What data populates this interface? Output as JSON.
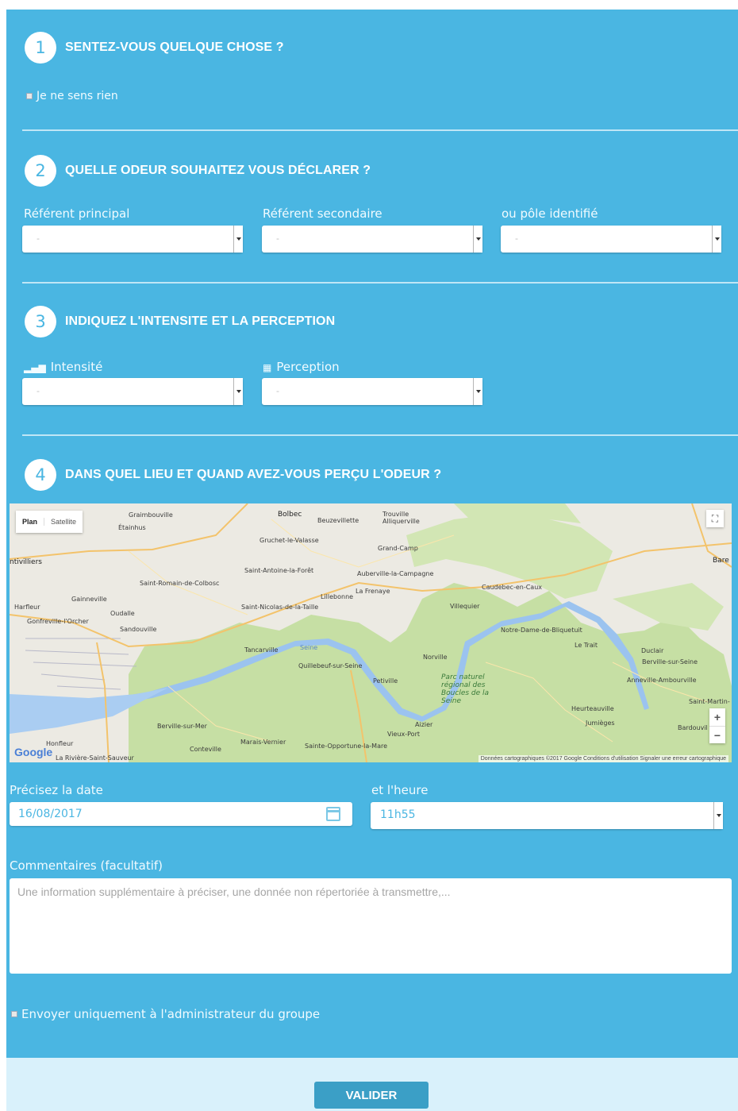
{
  "steps": [
    {
      "number": "1",
      "title": "SENTEZ-VOUS QUELQUE CHOSE ?"
    },
    {
      "number": "2",
      "title": "QUELLE ODEUR SOUHAITEZ VOUS DÉCLARER ?"
    },
    {
      "number": "3",
      "title": "INDIQUEZ L'INTENSITE ET LA PERCEPTION"
    },
    {
      "number": "4",
      "title": "DANS QUEL LIEU ET QUAND AVEZ-VOUS PERÇU L'ODEUR ?"
    }
  ],
  "section1": {
    "checkbox_label": "Je ne sens rien"
  },
  "section2": {
    "labels": [
      "Référent principal",
      "Référent secondaire",
      "ou pôle identifié"
    ],
    "select_values": [
      "-",
      "-",
      "-"
    ]
  },
  "section3": {
    "intensity_label": "Intensité",
    "perception_label": "Perception",
    "intensity_icon": "signal-bars-icon",
    "perception_icon": "table-grid-icon",
    "select_values": [
      "-",
      "-"
    ]
  },
  "map": {
    "type_plan": "Plan",
    "type_satellite": "Satellite",
    "logo": "Google",
    "attribution": "Données cartographiques ©2017 Google   Conditions d'utilisation   Signaler une erreur cartographique",
    "zoom_in": "+",
    "zoom_out": "−",
    "fullscreen": "⛶",
    "places": {
      "p1": "Graimbouville",
      "p2": "Étainhus",
      "p3": "Bolbec",
      "p4": "Beuzevillette",
      "p5": "Trouville Alliquerville",
      "p6": "Gruchet-le-Valasse",
      "p7": "Grand-Camp",
      "p8": "ntivilliers",
      "p9": "Saint-Antoine-la-Forêt",
      "p10": "Auberville-la-Campagne",
      "p11": "Saint-Romain-de-Colbosc",
      "p12": "Caudebec-en-Caux",
      "p13": "La Frenaye",
      "p14": "Lillebonne",
      "p15": "Gainneville",
      "p16": "Harfleur",
      "p17": "Saint-Nicolas-de-la-Taille",
      "p18": "Villequier",
      "p19": "Oudalle",
      "p20": "Gonfreville-l'Orcher",
      "p21": "Sandouville",
      "p22": "Notre-Dame-de-Bliquetuit",
      "p23": "Le Trait",
      "p24": "Tancarville",
      "p25": "Duclair",
      "p26": "Norville",
      "p27": "Berville-sur-Seine",
      "p28": "Quillebeuf-sur-Seine",
      "p29": "Petiville",
      "p30": "Anneville-Ambourville",
      "p31": "Parc naturel régional des Boucles de la Seine",
      "p32": "Saint-Martin-",
      "p33": "Heurteauville",
      "p34": "Jumièges",
      "p35": "Bardouvil",
      "p36": "Berville-sur-Mer",
      "p37": "Aizier",
      "p38": "Vieux-Port",
      "p39": "Honfleur",
      "p40": "Conteville",
      "p41": "Marais-Vernier",
      "p42": "Sainte-Opportune-la-Mare",
      "p43": "La Rivière-Saint-Sauveur",
      "p44": "Bare",
      "p45": "Seine"
    }
  },
  "date_field": {
    "label": "Précisez la date",
    "value": "16/08/2017"
  },
  "time_field": {
    "label": "et l'heure",
    "value": "11h55"
  },
  "comments": {
    "label": "Commentaires (facultatif)",
    "placeholder": "Une information supplémentaire à préciser, une donnée non répertoriée à transmettre,..."
  },
  "admin_only": {
    "label": "Envoyer uniquement à l'administrateur du groupe"
  },
  "submit": {
    "label": "VALIDER"
  },
  "colors": {
    "panel": "#4ab6e2",
    "footer": "#d9f1fb",
    "button": "#3b9fc6",
    "divider": "#bfe6f6"
  }
}
